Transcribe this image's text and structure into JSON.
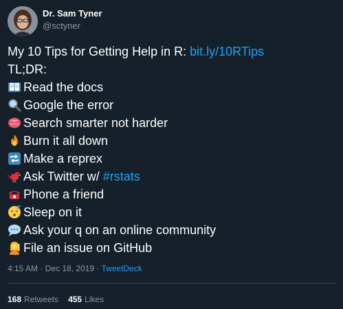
{
  "author": {
    "display_name": "Dr. Sam Tyner",
    "handle": "@sctyner"
  },
  "tweet": {
    "intro_text": "My 10 Tips for Getting Help in R: ",
    "intro_link": "bit.ly/10RTips",
    "tldr": "TL;DR:",
    "tips": [
      {
        "icon": "open-book-icon",
        "text": "Read the docs"
      },
      {
        "icon": "magnifying-glass-icon",
        "text": "Google the error"
      },
      {
        "icon": "brain-icon",
        "text": "Search smarter not harder"
      },
      {
        "icon": "fire-icon",
        "text": "Burn it all down"
      },
      {
        "icon": "repeat-arrows-icon",
        "text": "Make a reprex"
      },
      {
        "icon": "bird-icon",
        "text": "Ask Twitter w/ ",
        "link": "#rstats"
      },
      {
        "icon": "telephone-icon",
        "text": "Phone a friend"
      },
      {
        "icon": "sleeping-face-icon",
        "text": "Sleep on it"
      },
      {
        "icon": "speech-bubble-icon",
        "text": "Ask your q on an online community"
      },
      {
        "icon": "person-raising-hand-icon",
        "text": "File an issue on GitHub"
      }
    ]
  },
  "meta": {
    "timestamp": "4:15 AM · Dec 18, 2019 · ",
    "source": "TweetDeck"
  },
  "stats": {
    "retweets_count": "168",
    "retweets_label": "Retweets",
    "likes_count": "455",
    "likes_label": "Likes"
  },
  "colors": {
    "background": "#15202b",
    "link": "#1da1f2",
    "secondary_text": "#8899a6",
    "divider": "#38444d"
  }
}
